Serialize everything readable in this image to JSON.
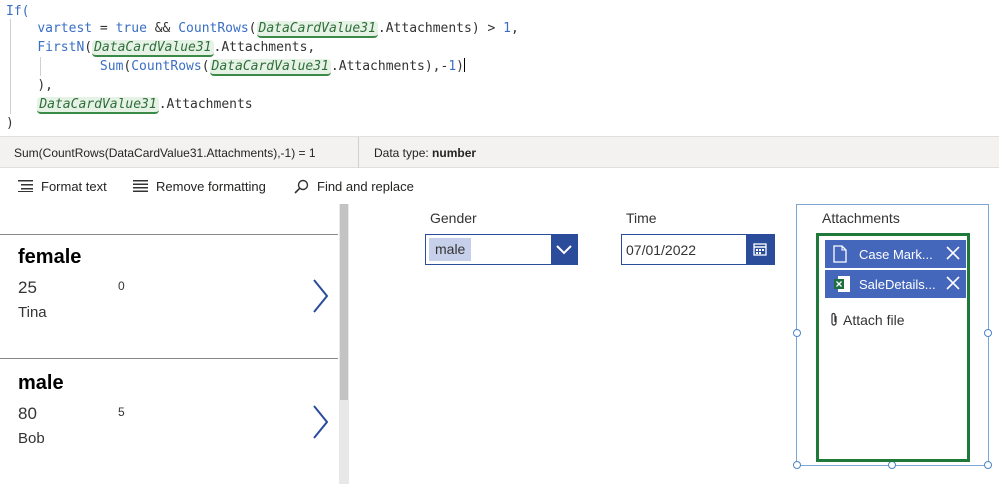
{
  "formula": {
    "lines": [
      {
        "indent": "",
        "parts": [
          {
            "t": "If(",
            "c": "kw"
          }
        ]
      },
      {
        "indent": "    ",
        "parts": [
          {
            "t": "vartest",
            "c": "kw"
          },
          {
            "t": " = ",
            "c": "plain"
          },
          {
            "t": "true",
            "c": "kw"
          },
          {
            "t": " && ",
            "c": "plain"
          },
          {
            "t": "CountRows",
            "c": "kw"
          },
          {
            "t": "(",
            "c": "plain"
          },
          {
            "t": "DataCardValue31",
            "c": "ref"
          },
          {
            "t": ".Attachments) > ",
            "c": "plain"
          },
          {
            "t": "1",
            "c": "kw"
          },
          {
            "t": ",",
            "c": "plain"
          }
        ]
      },
      {
        "indent": "    ",
        "parts": [
          {
            "t": "FirstN",
            "c": "kw"
          },
          {
            "t": "(",
            "c": "plain"
          },
          {
            "t": "DataCardValue31",
            "c": "ref"
          },
          {
            "t": ".Attachments,",
            "c": "plain"
          }
        ]
      },
      {
        "indent": "            ",
        "parts": [
          {
            "t": "Sum",
            "c": "kw"
          },
          {
            "t": "(",
            "c": "plain"
          },
          {
            "t": "CountRows",
            "c": "kw"
          },
          {
            "t": "(",
            "c": "plain"
          },
          {
            "t": "DataCardValue31",
            "c": "ref"
          },
          {
            "t": ".Attachments),-",
            "c": "plain"
          },
          {
            "t": "1",
            "c": "kw"
          },
          {
            "t": ")",
            "c": "plain"
          },
          {
            "t": "",
            "c": "caret"
          }
        ]
      },
      {
        "indent": "    ",
        "parts": [
          {
            "t": "),",
            "c": "plain"
          }
        ]
      },
      {
        "indent": "    ",
        "parts": [
          {
            "t": "DataCardValue31",
            "c": "ref"
          },
          {
            "t": ".Attachments",
            "c": "plain"
          }
        ]
      },
      {
        "indent": "",
        "parts": [
          {
            "t": ")",
            "c": "plain"
          }
        ]
      }
    ]
  },
  "result": {
    "expression": "Sum(CountRows(DataCardValue31.Attachments),-1)  =  1",
    "datatype_label": "Data type:",
    "datatype_value": "number"
  },
  "toolbar": {
    "format_text": "Format text",
    "remove_formatting": "Remove formatting",
    "find_replace": "Find and replace"
  },
  "gallery": {
    "items": [
      {
        "title": "female",
        "age": "25",
        "num": "0",
        "name": "Tina"
      },
      {
        "title": "male",
        "age": "80",
        "num": "5",
        "name": "Bob"
      }
    ]
  },
  "form": {
    "gender_label": "Gender",
    "gender_value": "male",
    "time_label": "Time",
    "time_value": "07/01/2022",
    "attachments_label": "Attachments",
    "attachments": [
      {
        "name": "Case Mark...",
        "type": "document"
      },
      {
        "name": "SaleDetails...",
        "type": "excel"
      }
    ],
    "attach_file_label": "Attach file"
  },
  "colors": {
    "accent_blue": "#2b4b9b",
    "attachment_item": "#4466bb",
    "attachment_border": "#1f7a3a",
    "reference_highlight": "#e6f2e6"
  }
}
